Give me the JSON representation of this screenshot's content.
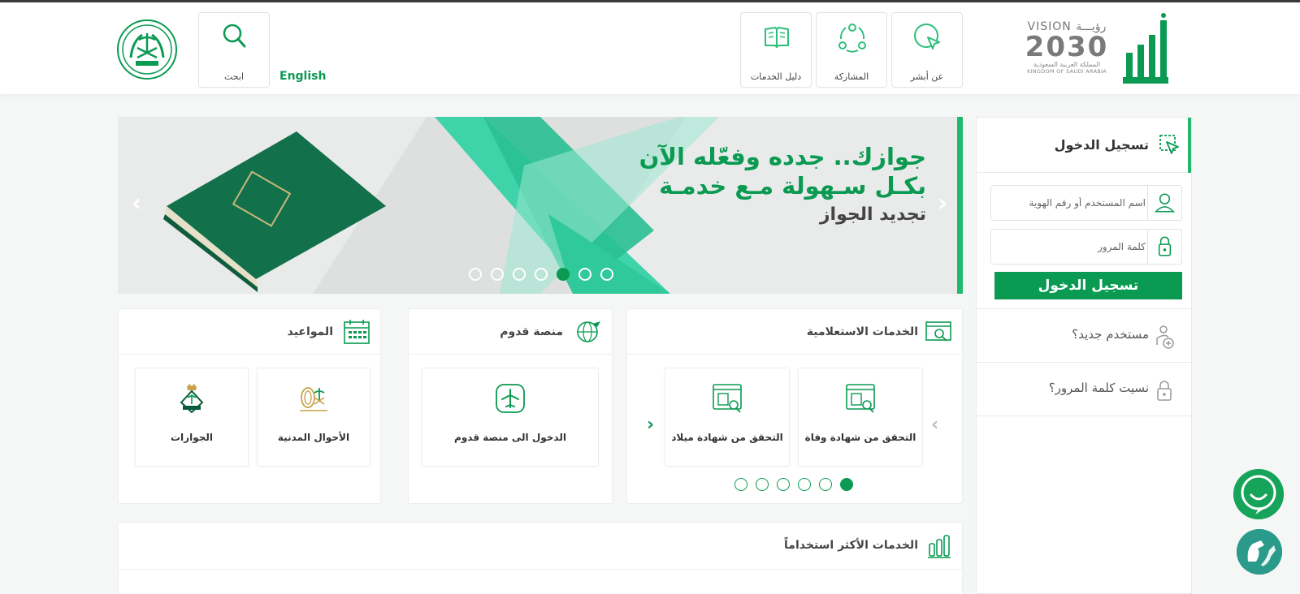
{
  "header": {
    "vision": {
      "top": "VISION رؤيـــة",
      "number": "2030",
      "ar": "المملكة العربية السعودية",
      "en": "KINGDOM OF SAUDI ARABIA"
    },
    "nav": [
      {
        "label": "عن أبشر",
        "icon": "cursor-circle-icon"
      },
      {
        "label": "المشاركة",
        "icon": "share-nodes-icon"
      },
      {
        "label": "دليل الخدمات",
        "icon": "book-icon"
      }
    ],
    "search_label": "ابحث",
    "language_link": "English"
  },
  "banner": {
    "line1": "جوازك.. جدده وفعّله الآن",
    "line2": "بكـل سـهولة مـع خدمـة",
    "line3": "تجديد الجواز",
    "slide_count": 7,
    "active_slide": 5
  },
  "login": {
    "title": "تسجيل الدخول",
    "username_placeholder": "اسم المستخدم أو رقم الهوية",
    "password_placeholder": "كلمة المرور",
    "submit_label": "تسجيل الدخول",
    "new_user": "مستخدم جديد؟",
    "forgot_password": "نسيت كلمة المرور؟"
  },
  "inquiry": {
    "title": "الخدمات الاستعلامية",
    "tiles": [
      "التحقق من شهادة وفاة",
      "التحقق من شهادة ميلاد"
    ],
    "dot_count": 6,
    "active_dot": 1
  },
  "qudoom": {
    "title": "منصة قدوم",
    "tile": "الدخول الى منصة قدوم"
  },
  "appointments": {
    "title": "المواعيد",
    "tiles": [
      "الأحوال المدنية",
      "الجوازات"
    ]
  },
  "most_used": {
    "title": "الخدمات الأكثر استخداماً"
  },
  "colors": {
    "primary": "#0a9a52",
    "accent": "#21b96c"
  }
}
